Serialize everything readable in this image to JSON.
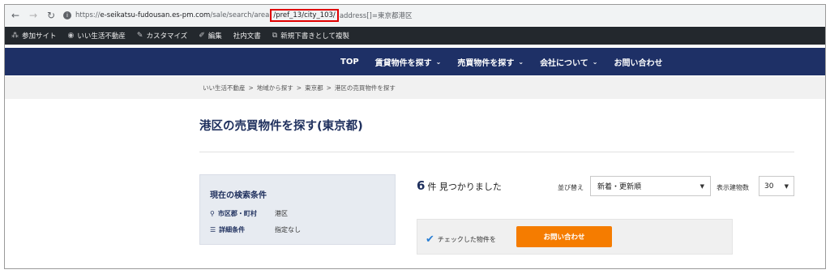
{
  "browser": {
    "url_prefix": "https://",
    "url_domain": "e-seikatsu-fudousan.es-pm.com",
    "url_path_before": "/sale/search/area",
    "url_highlight": "/pref_13/city_103/",
    "url_path_after": "address[]=東京都港区",
    "icons": [
      "back-arrow-icon",
      "forward-arrow-icon",
      "reload-icon",
      "site-info-icon"
    ]
  },
  "adminbar": {
    "items": [
      {
        "label": "参加サイト",
        "icon": "sites-icon"
      },
      {
        "label": "いい生活不動産",
        "icon": "dashboard-icon"
      },
      {
        "label": "カスタマイズ",
        "icon": "brush-icon"
      },
      {
        "label": "編集",
        "icon": "pencil-icon"
      },
      {
        "label": "社内文書",
        "icon": ""
      },
      {
        "label": "新規下書きとして複製",
        "icon": "duplicate-icon"
      }
    ]
  },
  "sitenav": {
    "items": [
      {
        "label": "TOP",
        "has_dropdown": false
      },
      {
        "label": "賃貸物件を探す",
        "has_dropdown": true
      },
      {
        "label": "売買物件を探す",
        "has_dropdown": true
      },
      {
        "label": "会社について",
        "has_dropdown": true
      },
      {
        "label": "お問い合わせ",
        "has_dropdown": false
      }
    ],
    "background": "#1e3066"
  },
  "breadcrumb": [
    "いい生活不動産",
    "地域から探す",
    "東京都",
    "港区の売買物件を探す"
  ],
  "breadcrumb_sep": ">",
  "page_title": "港区の売買物件を探す(東京都)",
  "conditions": {
    "heading": "現在の検索条件",
    "rows": [
      {
        "key": "市区郡・町村",
        "value": "港区",
        "icon": "map-pin-icon"
      },
      {
        "key": "詳細条件",
        "value": "指定なし",
        "icon": "list-icon"
      }
    ]
  },
  "results": {
    "count": "6",
    "count_suffix": "件 見つかりました",
    "sort_label": "並び替え",
    "sort_value": "新着・更新順",
    "per_page_label": "表示建物数",
    "per_page_value": "30"
  },
  "checkbar": {
    "label": "チェックした物件を",
    "button": "お問い合わせ",
    "button_color": "#f57c00"
  }
}
